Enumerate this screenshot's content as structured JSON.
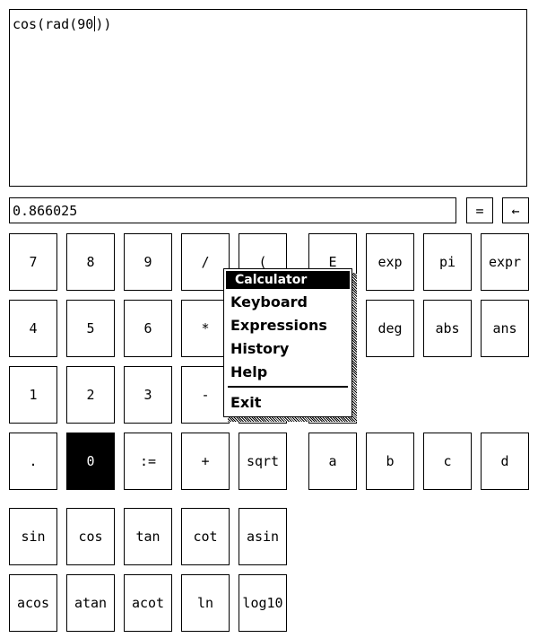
{
  "editor": {
    "text": "cos(rad(90",
    "text_after_caret": "))"
  },
  "result": {
    "value": "0.866025"
  },
  "controls": {
    "equals_label": "=",
    "backspace_label": "←"
  },
  "keypad": {
    "row1": [
      "7",
      "8",
      "9",
      "/",
      "(",
      "E",
      "exp",
      "pi",
      "expr"
    ],
    "row2": [
      "4",
      "5",
      "6",
      "*",
      "deg",
      "abs",
      "ans"
    ],
    "row3": [
      "1",
      "2",
      "3",
      "-"
    ],
    "row4": [
      ".",
      "0",
      ":=",
      "+",
      "sqrt",
      "a",
      "b",
      "c",
      "d"
    ],
    "row5": [
      "sin",
      "cos",
      "tan",
      "cot",
      "asin"
    ],
    "row6": [
      "acos",
      "atan",
      "acot",
      "ln",
      "log10"
    ]
  },
  "menu": {
    "title": "Calculator",
    "items": [
      "Keyboard",
      "Expressions",
      "History",
      "Help"
    ],
    "exit": "Exit"
  }
}
